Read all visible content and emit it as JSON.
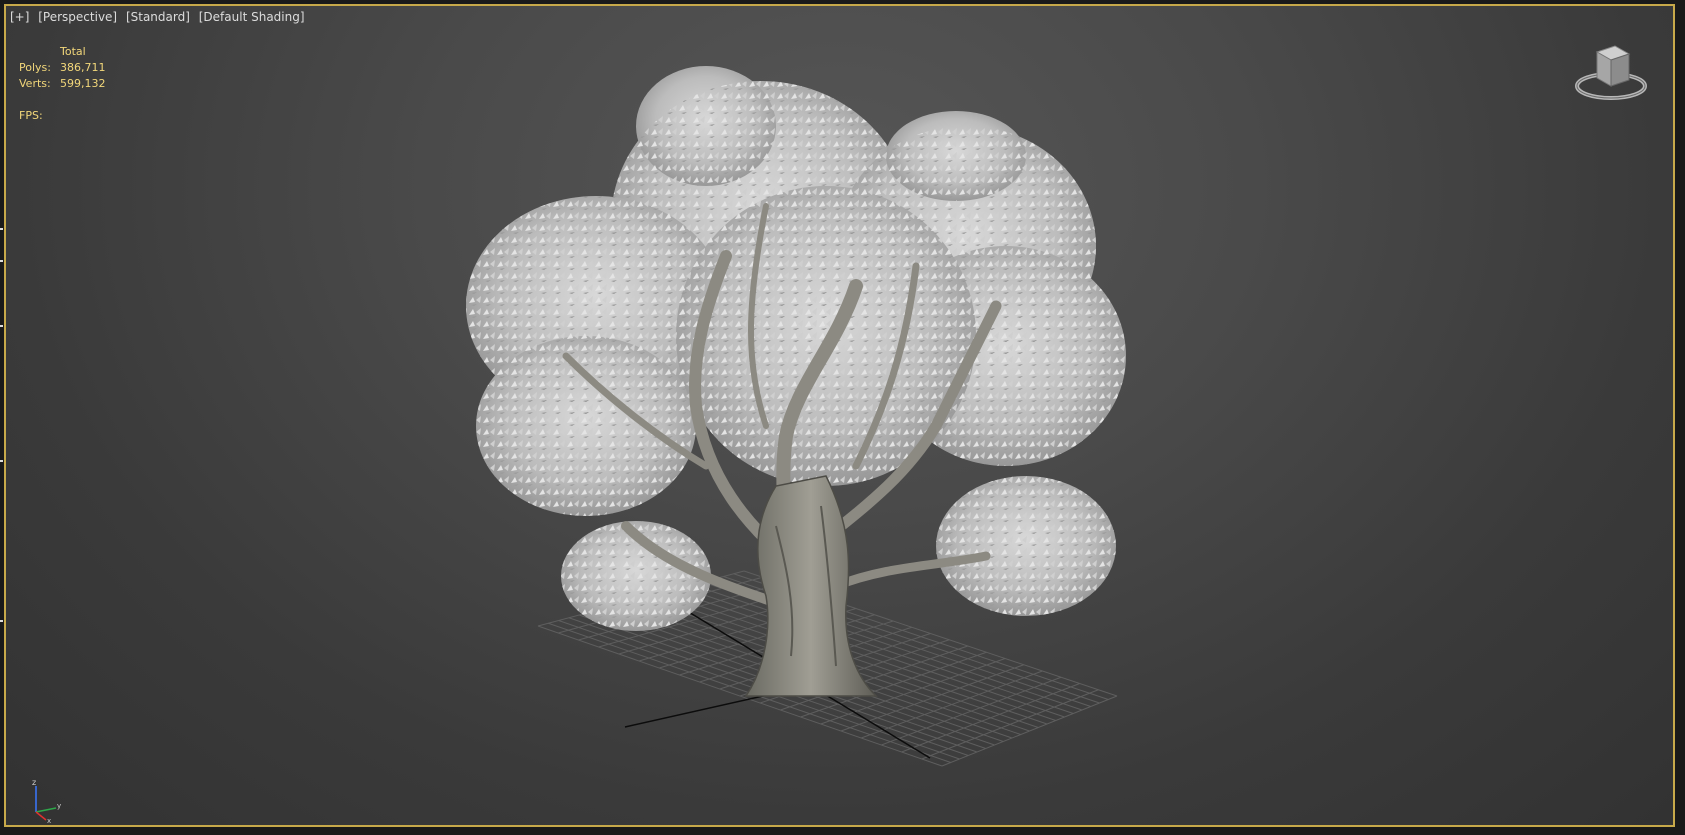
{
  "viewport": {
    "label_items": [
      "[+]",
      "[Perspective]",
      "[Standard]",
      "[Default Shading]"
    ],
    "stats": {
      "header": "Total",
      "rows": [
        {
          "key": "Polys:",
          "value": "386,711"
        },
        {
          "key": "Verts:",
          "value": "599,132"
        }
      ],
      "fps_label": "FPS:"
    },
    "viewcube_icon": "viewcube-navigation-icon",
    "axis_tripod_icon": "xyz-axis-tripod-icon",
    "axis_labels": {
      "z": "z",
      "x": "x",
      "y": "y"
    },
    "colors": {
      "border_active": "#c7a94a",
      "stats_text": "#f2d77a",
      "label_text": "#dcdcdc"
    }
  }
}
